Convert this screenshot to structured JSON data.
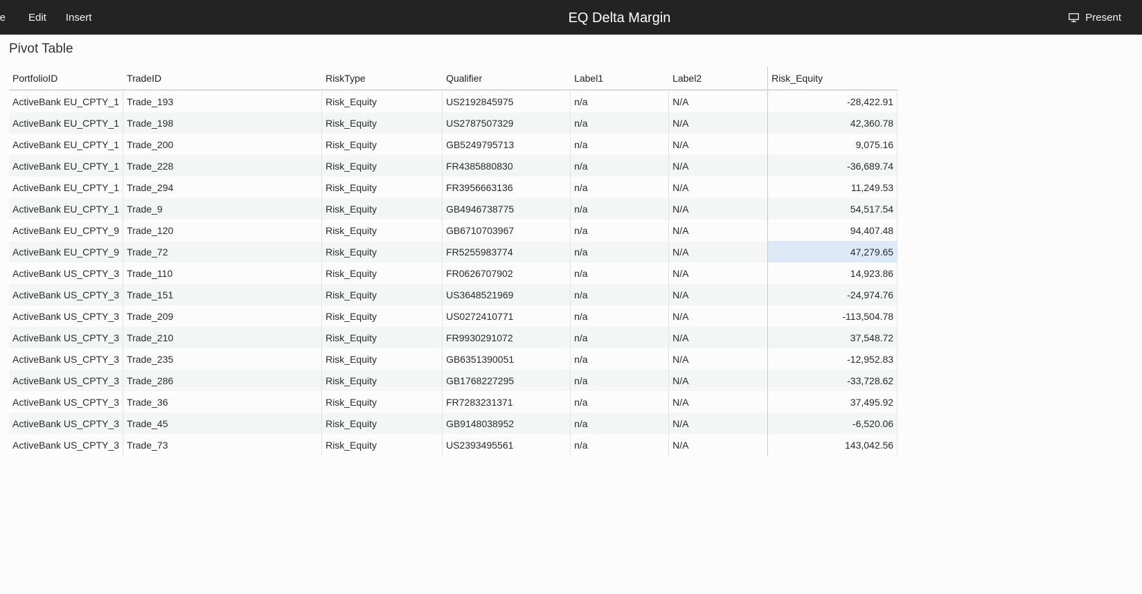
{
  "menu": {
    "items": [
      {
        "label": "File",
        "clipped": true
      },
      {
        "label": "Edit"
      },
      {
        "label": "Insert"
      }
    ]
  },
  "app": {
    "title": "EQ Delta Margin"
  },
  "present": {
    "label": "Present",
    "icon": "monitor-icon"
  },
  "section": {
    "title": "Pivot Table"
  },
  "table": {
    "headers": [
      "PortfolioID",
      "TradeID",
      "RiskType",
      "Qualifier",
      "Label1",
      "Label2",
      "Risk_Equity"
    ],
    "rows": [
      [
        "ActiveBank EU_CPTY_1",
        "Trade_193",
        "Risk_Equity",
        "US2192845975",
        "n/a",
        "N/A",
        "-28,422.91"
      ],
      [
        "ActiveBank EU_CPTY_1",
        "Trade_198",
        "Risk_Equity",
        "US2787507329",
        "n/a",
        "N/A",
        "42,360.78"
      ],
      [
        "ActiveBank EU_CPTY_1",
        "Trade_200",
        "Risk_Equity",
        "GB5249795713",
        "n/a",
        "N/A",
        "9,075.16"
      ],
      [
        "ActiveBank EU_CPTY_1",
        "Trade_228",
        "Risk_Equity",
        "FR4385880830",
        "n/a",
        "N/A",
        "-36,689.74"
      ],
      [
        "ActiveBank EU_CPTY_1",
        "Trade_294",
        "Risk_Equity",
        "FR3956663136",
        "n/a",
        "N/A",
        "11,249.53"
      ],
      [
        "ActiveBank EU_CPTY_1",
        "Trade_9",
        "Risk_Equity",
        "GB4946738775",
        "n/a",
        "N/A",
        "54,517.54"
      ],
      [
        "ActiveBank EU_CPTY_9",
        "Trade_120",
        "Risk_Equity",
        "GB6710703967",
        "n/a",
        "N/A",
        "94,407.48"
      ],
      [
        "ActiveBank EU_CPTY_9",
        "Trade_72",
        "Risk_Equity",
        "FR5255983774",
        "n/a",
        "N/A",
        "47,279.65"
      ],
      [
        "ActiveBank US_CPTY_3",
        "Trade_110",
        "Risk_Equity",
        "FR0626707902",
        "n/a",
        "N/A",
        "14,923.86"
      ],
      [
        "ActiveBank US_CPTY_3",
        "Trade_151",
        "Risk_Equity",
        "US3648521969",
        "n/a",
        "N/A",
        "-24,974.76"
      ],
      [
        "ActiveBank US_CPTY_3",
        "Trade_209",
        "Risk_Equity",
        "US0272410771",
        "n/a",
        "N/A",
        "-113,504.78"
      ],
      [
        "ActiveBank US_CPTY_3",
        "Trade_210",
        "Risk_Equity",
        "FR9930291072",
        "n/a",
        "N/A",
        "37,548.72"
      ],
      [
        "ActiveBank US_CPTY_3",
        "Trade_235",
        "Risk_Equity",
        "GB6351390051",
        "n/a",
        "N/A",
        "-12,952.83"
      ],
      [
        "ActiveBank US_CPTY_3",
        "Trade_286",
        "Risk_Equity",
        "GB1768227295",
        "n/a",
        "N/A",
        "-33,728.62"
      ],
      [
        "ActiveBank US_CPTY_3",
        "Trade_36",
        "Risk_Equity",
        "FR7283231371",
        "n/a",
        "N/A",
        "37,495.92"
      ],
      [
        "ActiveBank US_CPTY_3",
        "Trade_45",
        "Risk_Equity",
        "GB9148038952",
        "n/a",
        "N/A",
        "-6,520.06"
      ],
      [
        "ActiveBank US_CPTY_3",
        "Trade_73",
        "Risk_Equity",
        "US2393495561",
        "n/a",
        "N/A",
        "143,042.56"
      ]
    ],
    "selected_row": 7,
    "selected_column": 6
  },
  "colors": {
    "topbar": "#232323",
    "selection": "#dde9f6",
    "stripe": "#f4f5f5"
  }
}
